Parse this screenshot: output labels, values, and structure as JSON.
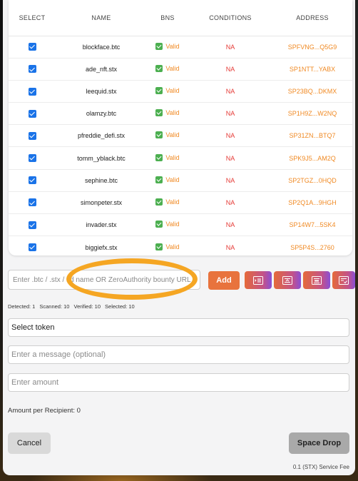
{
  "table": {
    "headers": {
      "select": "SELECT",
      "name": "NAME",
      "bns": "BNS",
      "conditions": "CONDITIONS",
      "address": "ADDRESS"
    },
    "rows": [
      {
        "selected": true,
        "name": "blockface.btc",
        "bns": "Valid",
        "conditions": "NA",
        "address": "SPFVNG...Q5G9"
      },
      {
        "selected": true,
        "name": "ade_nft.stx",
        "bns": "Valid",
        "conditions": "NA",
        "address": "SP1NTT...YABX"
      },
      {
        "selected": true,
        "name": "leequid.stx",
        "bns": "Valid",
        "conditions": "NA",
        "address": "SP23BQ...DKMX"
      },
      {
        "selected": true,
        "name": "olamzy.btc",
        "bns": "Valid",
        "conditions": "NA",
        "address": "SP1H9Z...W2NQ"
      },
      {
        "selected": true,
        "name": "pfreddie_defi.stx",
        "bns": "Valid",
        "conditions": "NA",
        "address": "SP31ZN...BTQ7"
      },
      {
        "selected": true,
        "name": "tomm_yblack.btc",
        "bns": "Valid",
        "conditions": "NA",
        "address": "SPK9J5...AM2Q"
      },
      {
        "selected": true,
        "name": "sephine.btc",
        "bns": "Valid",
        "conditions": "NA",
        "address": "SP2TGZ...0HQD"
      },
      {
        "selected": true,
        "name": "simonpeter.stx",
        "bns": "Valid",
        "conditions": "NA",
        "address": "SP2Q1A...9HGH"
      },
      {
        "selected": true,
        "name": "invader.stx",
        "bns": "Valid",
        "conditions": "NA",
        "address": "SP14W7...5SK4"
      },
      {
        "selected": true,
        "name": "biggiefx.stx",
        "bns": "Valid",
        "conditions": "NA",
        "address": "SP5P4S...2760"
      }
    ]
  },
  "recipient_input": {
    "placeholder": "Enter .btc / .stx / .id name OR ZeroAuthority bounty URL",
    "value": ""
  },
  "add_button": "Add",
  "toolbar_icons": [
    "list-indent-icon",
    "list-upload-icon",
    "list-filter-icon",
    "list-check-icon"
  ],
  "stats": {
    "detected": "Detected: 1",
    "scanned": "Scanned: 10",
    "verified": "Verified: 10",
    "selected": "Selected: 10"
  },
  "token_select": {
    "value": "Select token"
  },
  "message_input": {
    "placeholder": "Enter a message (optional)"
  },
  "amount_input": {
    "placeholder": "Enter amount"
  },
  "amount_per_recipient": "Amount per Recipient: 0",
  "cancel_button": "Cancel",
  "submit_button": "Space Drop",
  "service_fee": "0.1 (STX) Service Fee",
  "colors": {
    "accent": "#f08a24",
    "error": "#e53935",
    "valid": "#4caf50",
    "checkbox": "#1a73e8",
    "highlight": "#f5a623"
  }
}
